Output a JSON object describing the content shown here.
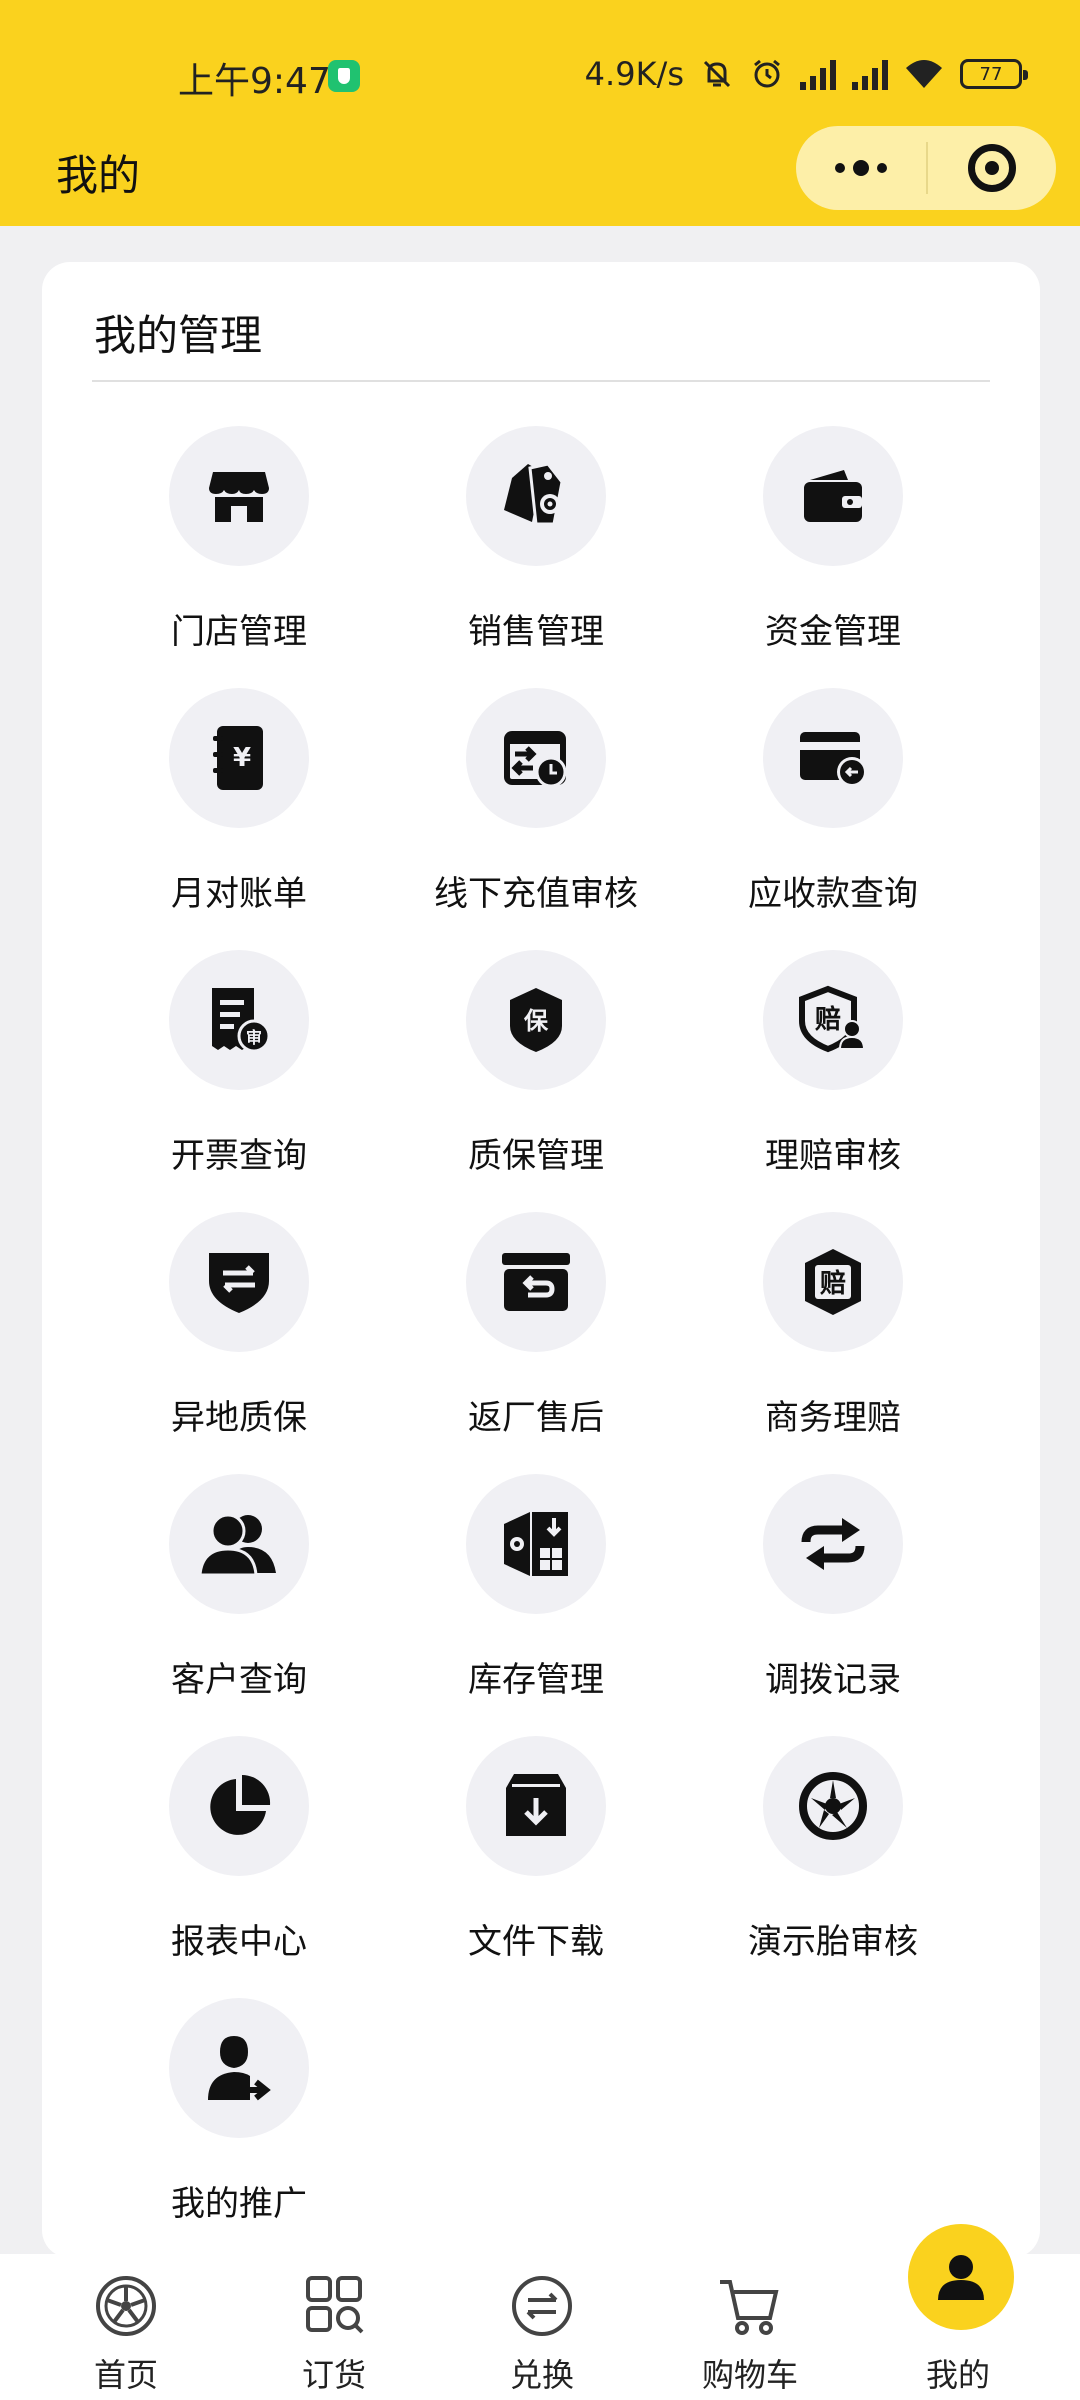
{
  "status_bar": {
    "time": "上午9:47",
    "speed": "4.9K/s",
    "battery": "77"
  },
  "nav": {
    "title": "我的"
  },
  "card": {
    "title": "我的管理",
    "items": [
      {
        "label": "门店管理",
        "icon": "store-icon"
      },
      {
        "label": "销售管理",
        "icon": "price-tag-icon"
      },
      {
        "label": "资金管理",
        "icon": "wallet-icon"
      },
      {
        "label": "月对账单",
        "icon": "ledger-book-icon"
      },
      {
        "label": "线下充值审核",
        "icon": "recharge-review-icon"
      },
      {
        "label": "应收款查询",
        "icon": "receivable-card-icon"
      },
      {
        "label": "开票查询",
        "icon": "invoice-icon"
      },
      {
        "label": "质保管理",
        "icon": "warranty-shield-icon"
      },
      {
        "label": "理赔审核",
        "icon": "claim-review-icon"
      },
      {
        "label": "异地质保",
        "icon": "transfer-shield-icon"
      },
      {
        "label": "返厂售后",
        "icon": "return-box-icon"
      },
      {
        "label": "商务理赔",
        "icon": "claim-badge-icon"
      },
      {
        "label": "客户查询",
        "icon": "customers-icon"
      },
      {
        "label": "库存管理",
        "icon": "inventory-icon"
      },
      {
        "label": "调拨记录",
        "icon": "swap-arrows-icon"
      },
      {
        "label": "报表中心",
        "icon": "pie-chart-icon"
      },
      {
        "label": "文件下载",
        "icon": "download-box-icon"
      },
      {
        "label": "演示胎审核",
        "icon": "tire-wheel-icon"
      },
      {
        "label": "我的推广",
        "icon": "user-share-icon"
      }
    ]
  },
  "tabbar": {
    "items": [
      {
        "label": "首页",
        "icon": "home-wheel-icon"
      },
      {
        "label": "订货",
        "icon": "order-grid-icon"
      },
      {
        "label": "兑换",
        "icon": "exchange-icon"
      },
      {
        "label": "购物车",
        "icon": "cart-icon"
      },
      {
        "label": "我的",
        "icon": "profile-icon"
      }
    ],
    "active": "我的"
  },
  "colors": {
    "brand_yellow": "#fad21e",
    "capsule": "#fdefa8",
    "icon_bg": "#f0f0f4"
  }
}
